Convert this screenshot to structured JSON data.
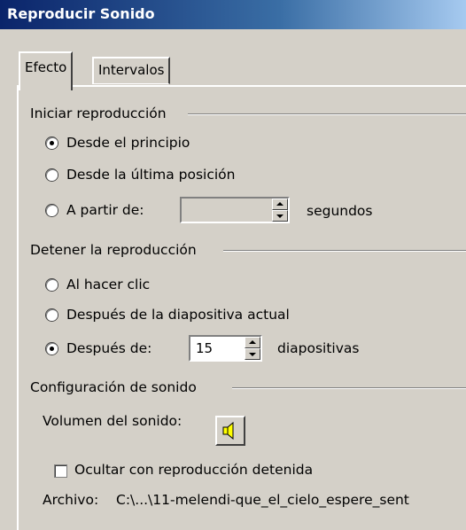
{
  "window": {
    "title": "Reproducir Sonido"
  },
  "tabs": [
    {
      "label": "Efecto",
      "active": true
    },
    {
      "label": "Intervalos",
      "active": false
    }
  ],
  "start_group": {
    "label": "Iniciar reproducción",
    "options": [
      {
        "label": "Desde el principio",
        "checked": true
      },
      {
        "label": "Desde la última posición",
        "checked": false
      },
      {
        "label": "A partir de:",
        "checked": false
      }
    ],
    "seconds_value": "",
    "seconds_unit": "segundos"
  },
  "stop_group": {
    "label": "Detener la reproducción",
    "options": [
      {
        "label": "Al hacer clic",
        "checked": false
      },
      {
        "label": "Después de la diapositiva actual",
        "checked": false
      },
      {
        "label": "Después de:",
        "checked": true
      }
    ],
    "slides_value": "15",
    "slides_unit": "diapositivas"
  },
  "sound_group": {
    "label": "Configuración de sonido",
    "volume_label": "Volumen del sonido:",
    "volume_icon": "speaker-icon",
    "hide_label": "Ocultar con reproducción detenida",
    "hide_checked": false,
    "file_label": "Archivo:",
    "file_path": "C:\\...\\11-melendi-que_el_cielo_espere_sent"
  }
}
